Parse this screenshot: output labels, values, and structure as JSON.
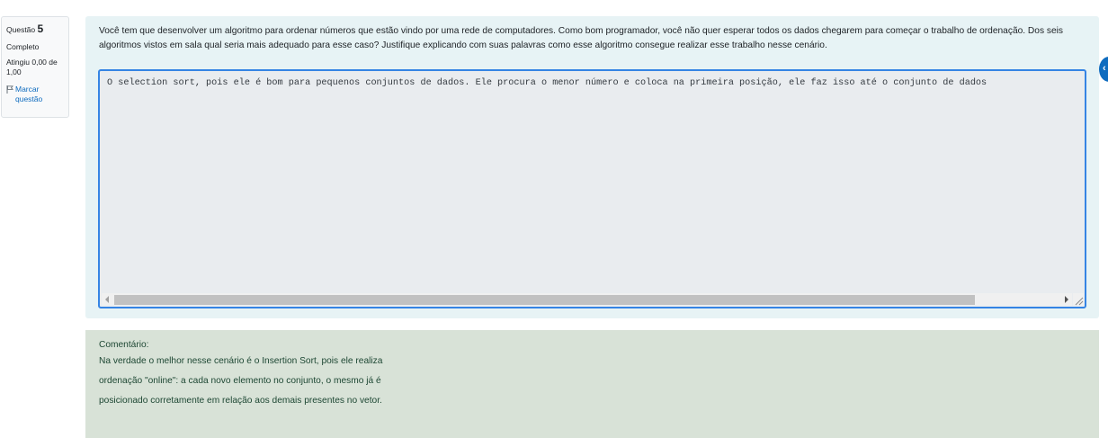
{
  "info": {
    "question_label": "Questão",
    "question_number": "5",
    "state": "Completo",
    "grade": "Atingiu 0,00 de 1,00",
    "flag_label": "Marcar questão"
  },
  "question": {
    "text": "Você tem que desenvolver um algoritmo para ordenar números que estão vindo por uma rede de computadores. Como bom programador, você não quer esperar todos os dados chegarem para começar o trabalho de ordenação. Dos seis algoritmos vistos em sala qual seria mais adequado para esse caso? Justifique explicando com suas palavras como esse algoritmo consegue realizar esse trabalho nesse cenário.",
    "answer": "O selection sort, pois ele é bom para pequenos conjuntos de dados. Ele procura o menor número e coloca na primeira posição, ele faz isso até o conjunto de dados"
  },
  "feedback": {
    "title": "Comentário:",
    "lines": [
      "Na verdade o melhor nesse cenário é o Insertion Sort, pois ele realiza",
      "ordenação \"online\": a cada novo elemento no conjunto, o mesmo já é",
      "posicionado corretamente em relação aos demais presentes no vetor."
    ]
  },
  "colors": {
    "accent": "#0f6cbf",
    "formulation_bg": "#e7f3f5",
    "feedback_bg": "#d8e2d7",
    "editor_border": "#3584e4"
  },
  "icons": {
    "flag": "flag-icon"
  }
}
